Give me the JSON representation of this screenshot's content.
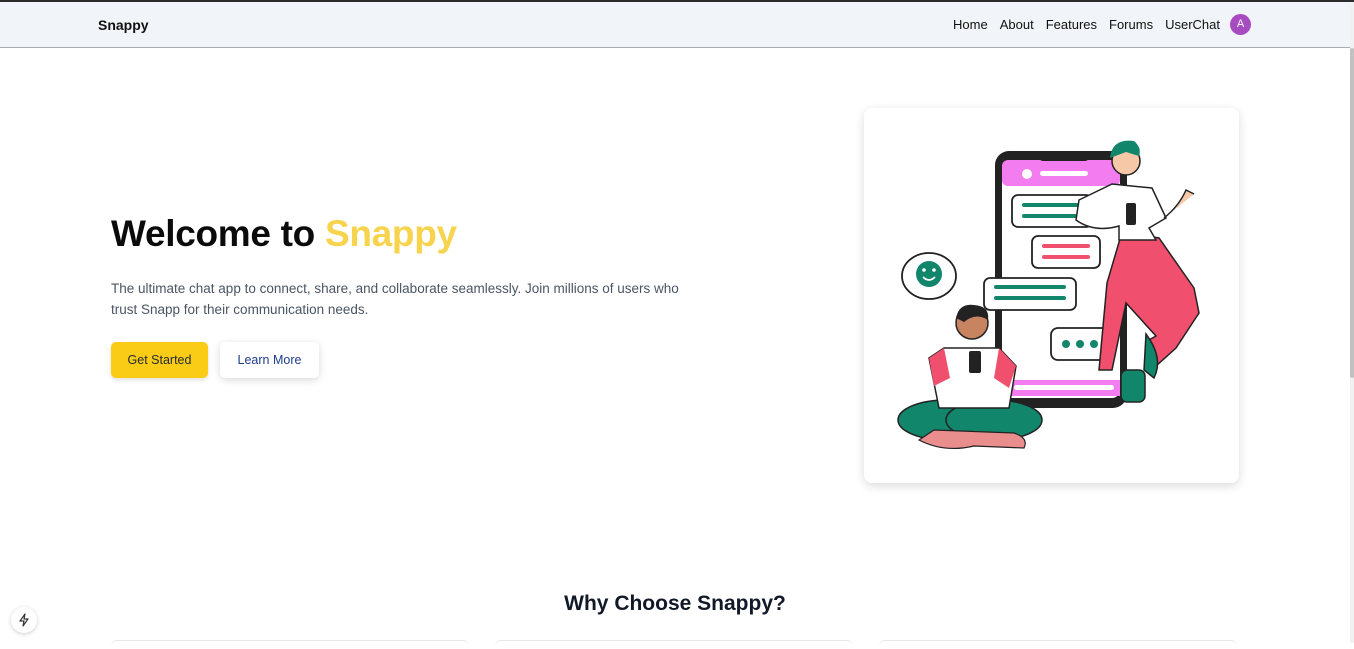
{
  "nav": {
    "brand": "Snappy",
    "links": [
      "Home",
      "About",
      "Features",
      "Forums",
      "UserChat"
    ],
    "avatar_initial": "A"
  },
  "hero": {
    "title_prefix": "Welcome to ",
    "title_accent": "Snappy",
    "description": "The ultimate chat app to connect, share, and collaborate seamlessly. Join millions of users who trust Snapp for their communication needs.",
    "primary_button": "Get Started",
    "secondary_button": "Learn More"
  },
  "features": {
    "title": "Why Choose Snappy?"
  },
  "colors": {
    "accent": "#facc15",
    "accent_text": "#f8d34d",
    "avatar": "#a64bc0",
    "illustration_green": "#12866a",
    "illustration_pink": "#f0506e",
    "illustration_magenta": "#f27cf0"
  },
  "icons": {
    "dev_tools": "lightning-icon",
    "illustration": "chat-people-illustration"
  }
}
